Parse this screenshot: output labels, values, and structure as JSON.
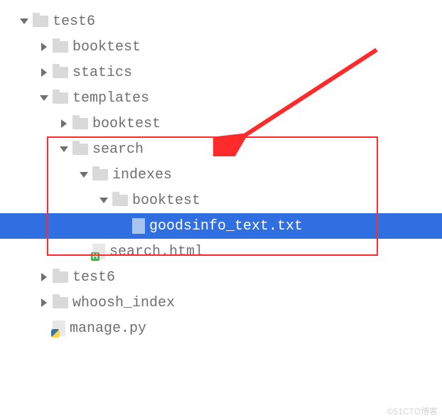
{
  "tree": {
    "root": "test6",
    "items": [
      "booktest",
      "statics",
      "templates",
      "search",
      "indexes",
      "booktest",
      "goodsinfo_text.txt",
      "search.html",
      "test6",
      "whoosh_index",
      "manage.py"
    ],
    "templates_child": "booktest"
  },
  "watermark": "©51CTO博客"
}
